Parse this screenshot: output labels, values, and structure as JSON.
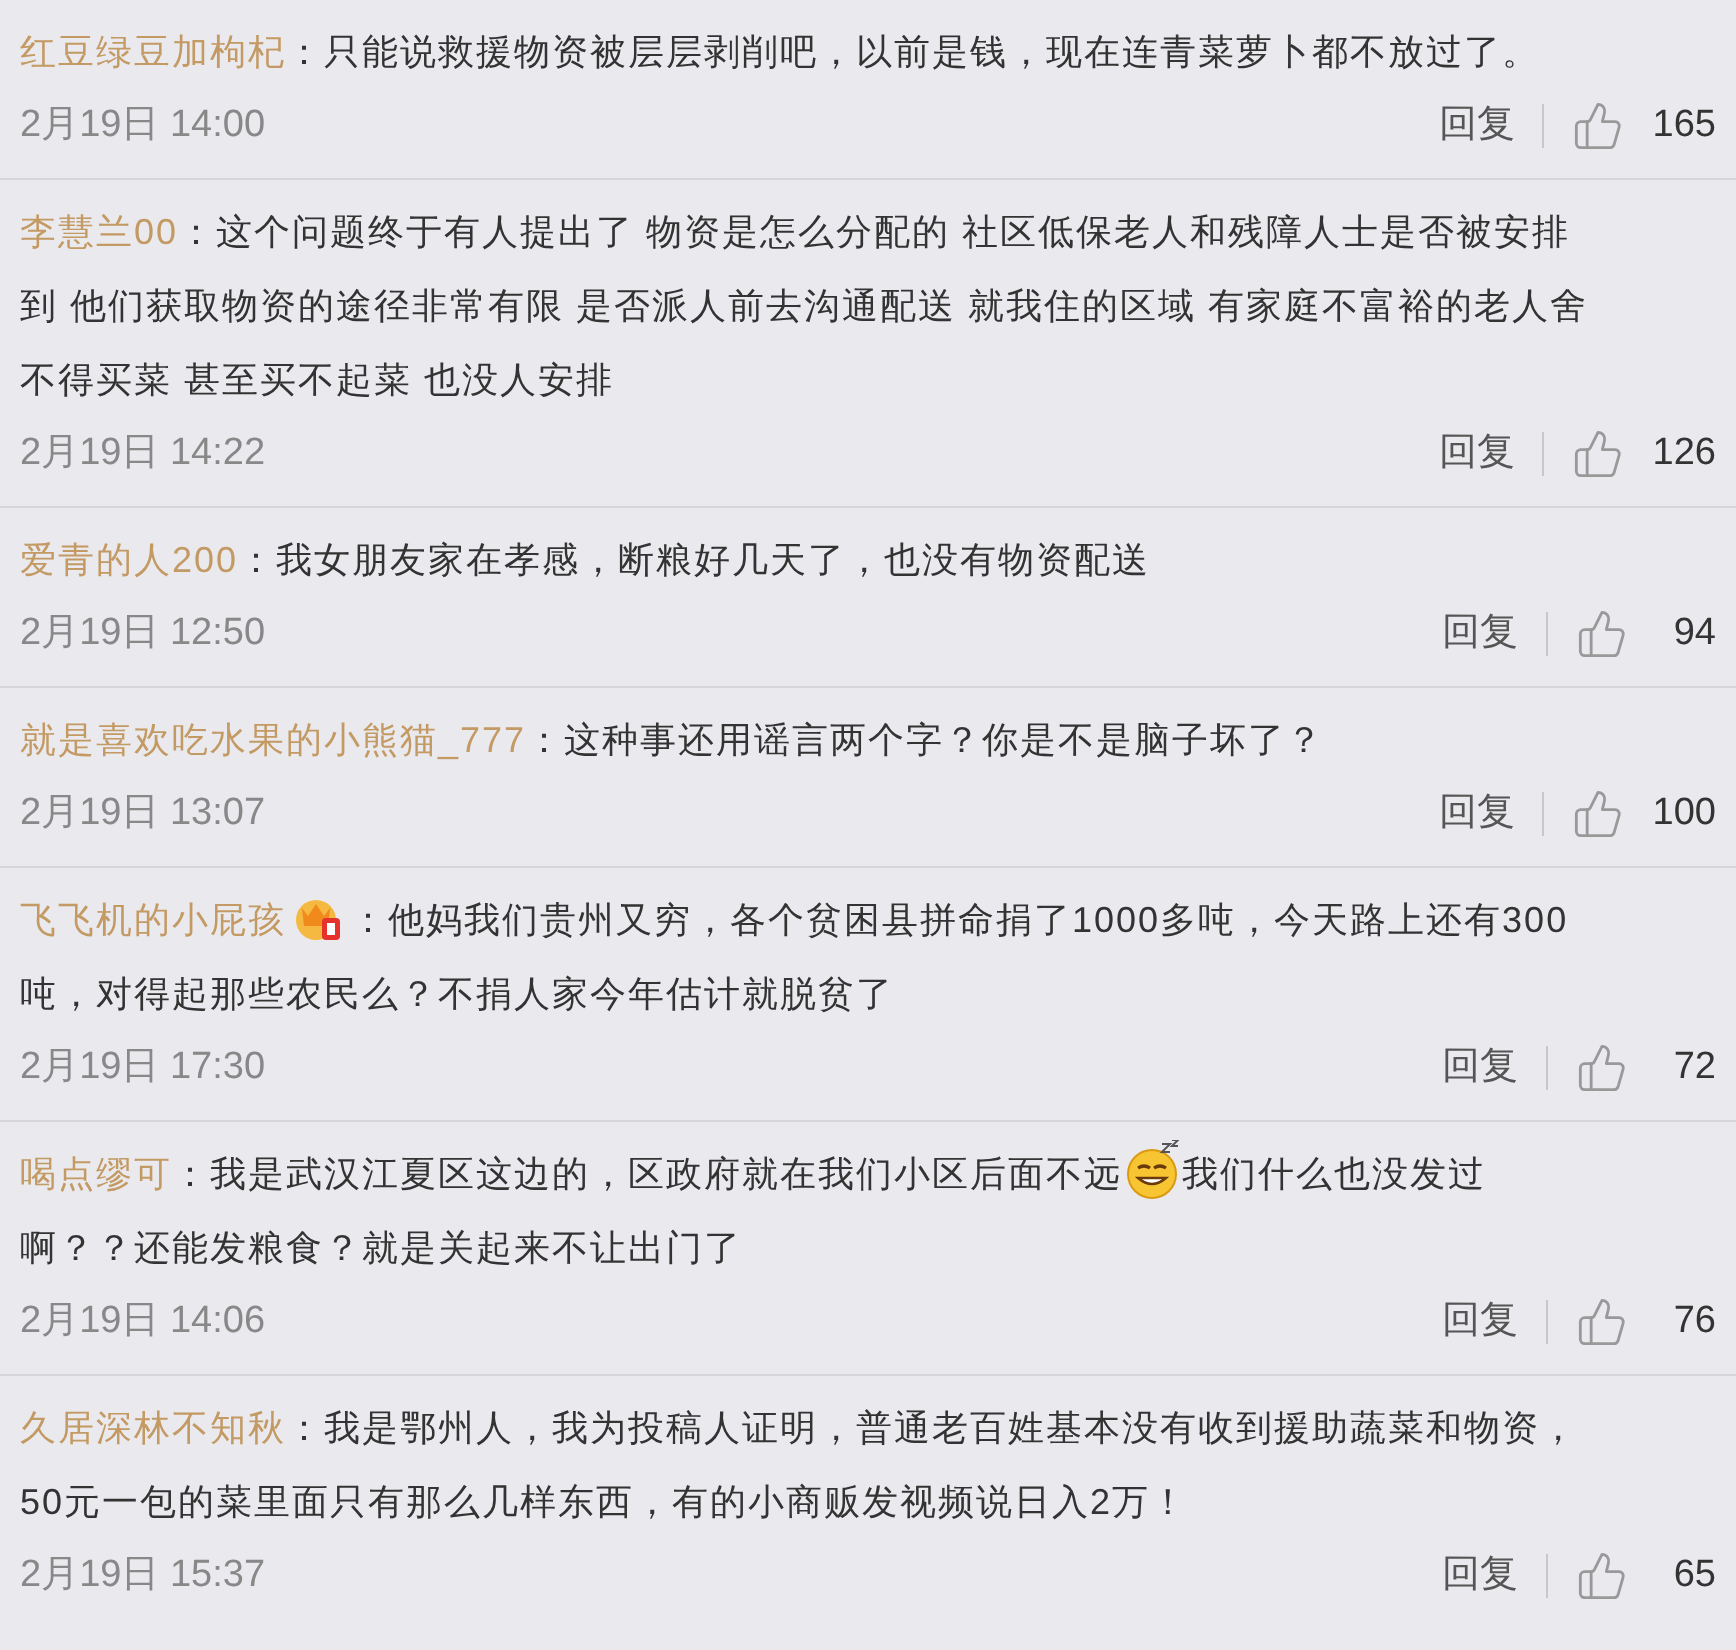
{
  "comments": [
    {
      "author": "红豆绿豆加枸杞",
      "badge": false,
      "lines": [
        [
          {
            "kind": "text",
            "text": "：只能说救援物资被层层剥削吧，以前是钱，现在连青菜萝卜都不放过了。"
          }
        ]
      ],
      "time": "2月19日 14:00",
      "reply": "回复",
      "likes": "165"
    },
    {
      "author": "李慧兰00",
      "badge": false,
      "lines": [
        [
          {
            "kind": "text",
            "text": "：这个问题终于有人提出了 物资是怎么分配的 社区低保老人和残障人士是否被安排"
          }
        ],
        [
          {
            "kind": "text",
            "text": "到 他们获取物资的途径非常有限 是否派人前去沟通配送 就我住的区域 有家庭不富裕的老人舍"
          }
        ],
        [
          {
            "kind": "text",
            "text": "不得买菜 甚至买不起菜 也没人安排"
          }
        ]
      ],
      "time": "2月19日 14:22",
      "reply": "回复",
      "likes": "126"
    },
    {
      "author": "爱青的人200",
      "badge": false,
      "lines": [
        [
          {
            "kind": "text",
            "text": "：我女朋友家在孝感，断粮好几天了，也没有物资配送"
          }
        ]
      ],
      "time": "2月19日 12:50",
      "reply": "回复",
      "likes": "94"
    },
    {
      "author": "就是喜欢吃水果的小熊猫_777",
      "badge": false,
      "lines": [
        [
          {
            "kind": "text",
            "text": "：这种事还用谣言两个字？你是不是脑子坏了？"
          }
        ]
      ],
      "time": "2月19日 13:07",
      "reply": "回复",
      "likes": "100"
    },
    {
      "author": "飞飞机的小屁孩",
      "badge": true,
      "lines": [
        [
          {
            "kind": "text",
            "text": "：他妈我们贵州又穷，各个贫困县拼命捐了1000多吨，今天路上还有300"
          }
        ],
        [
          {
            "kind": "text",
            "text": "吨，对得起那些农民么？不捐人家今年估计就脱贫了"
          }
        ]
      ],
      "time": "2月19日 17:30",
      "reply": "回复",
      "likes": "72"
    },
    {
      "author": "喝点缪可",
      "badge": false,
      "lines": [
        [
          {
            "kind": "text",
            "text": "：我是武汉江夏区这边的，区政府就在我们小区后面不远"
          },
          {
            "kind": "emoji"
          },
          {
            "kind": "text",
            "text": "我们什么也没发过"
          }
        ],
        [
          {
            "kind": "text",
            "text": "啊？？还能发粮食？就是关起来不让出门了"
          }
        ]
      ],
      "time": "2月19日 14:06",
      "reply": "回复",
      "likes": "76"
    },
    {
      "author": "久居深林不知秋",
      "badge": false,
      "lines": [
        [
          {
            "kind": "text",
            "text": "：我是鄂州人，我为投稿人证明，普通老百姓基本没有收到援助蔬菜和物资，"
          }
        ],
        [
          {
            "kind": "text",
            "text": "50元一包的菜里面只有那么几样东西，有的小商贩发视频说日入2万！"
          }
        ]
      ],
      "time": "2月19日 15:37",
      "reply": "回复",
      "likes": "65"
    }
  ]
}
